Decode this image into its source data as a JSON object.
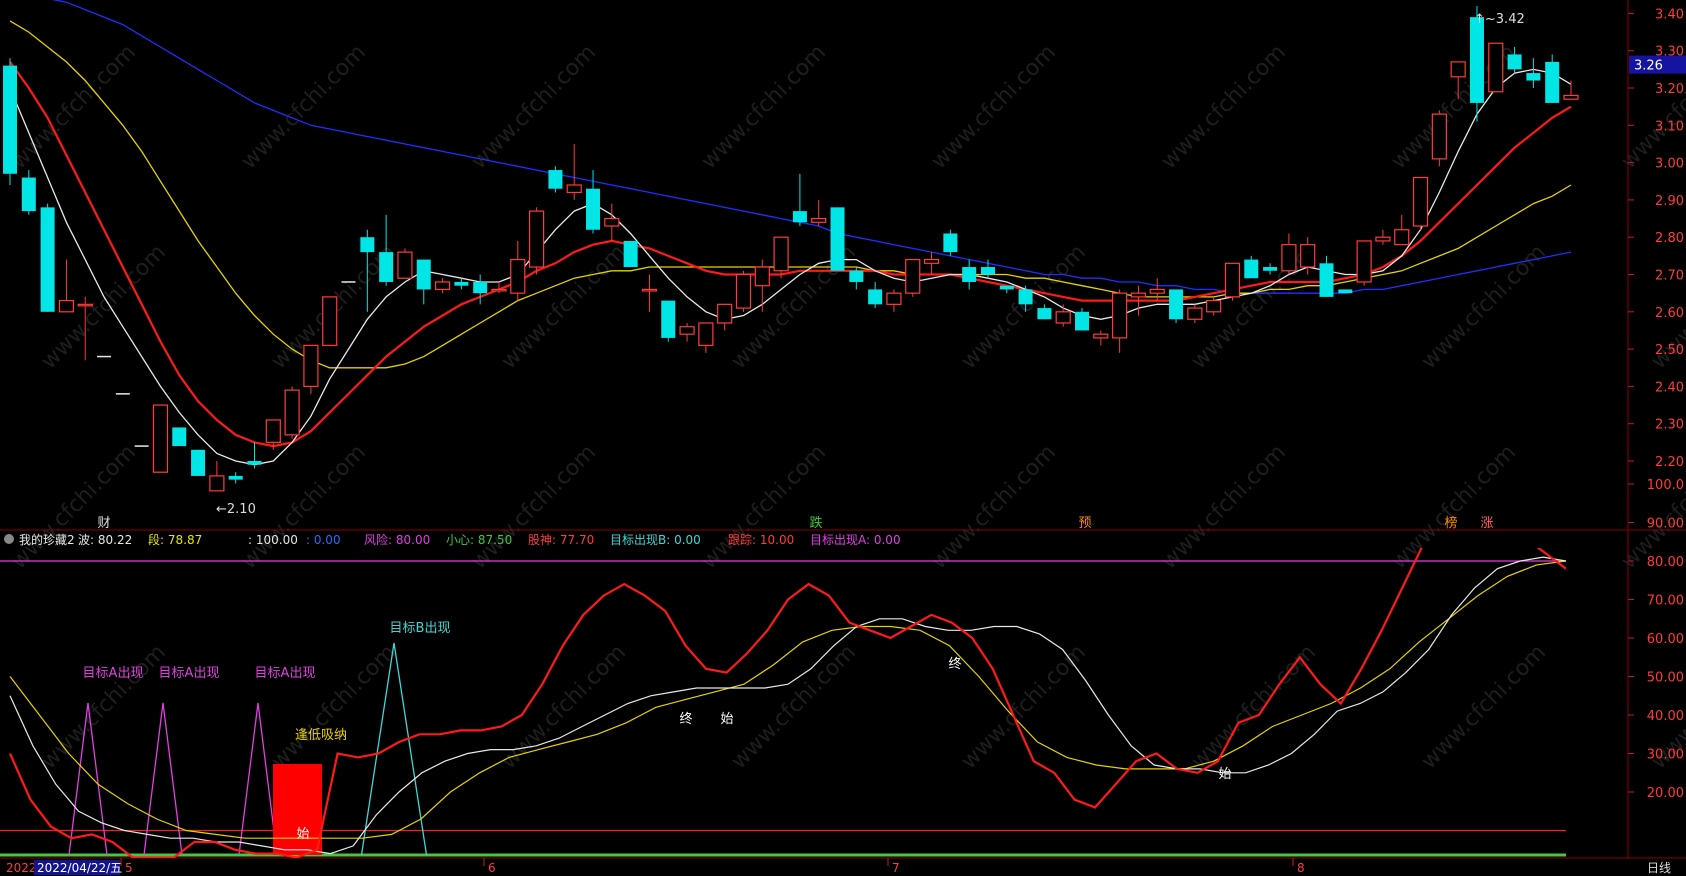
{
  "main_axis": {
    "ticks": [
      "3.40",
      "3.30",
      "3.20",
      "3.10",
      "3.00",
      "2.90",
      "2.80",
      "2.70",
      "2.60",
      "2.50",
      "2.40",
      "2.30",
      "2.20"
    ],
    "current_price": "3.26"
  },
  "main_annotations": {
    "high": "3.42",
    "low": "2.10"
  },
  "event_markers": [
    "财",
    "跌",
    "预",
    "榜",
    "涨"
  ],
  "indicator_header": {
    "name": "我的珍藏2",
    "items": [
      {
        "label": "波:",
        "value": "80.22",
        "color": "#e6e6e6"
      },
      {
        "label": "段:",
        "value": "78.87",
        "color": "#e6e600"
      },
      {
        "label": ":",
        "value": "100.00",
        "color": "#e6e6e6"
      },
      {
        "label": ":",
        "value": "0.00",
        "color": "#2b6bff"
      },
      {
        "label": "风险:",
        "value": "80.00",
        "color": "#e040e0"
      },
      {
        "label": "小心:",
        "value": "87.50",
        "color": "#3ccc3c"
      },
      {
        "label": "股神:",
        "value": "77.70",
        "color": "#ff3b3b"
      },
      {
        "label": "目标出现B:",
        "value": "0.00",
        "color": "#3fd6d6"
      },
      {
        "label": "跟踪:",
        "value": "10.00",
        "color": "#ff3b3b"
      },
      {
        "label": "目标出现A:",
        "value": "0.00",
        "color": "#e040e0"
      }
    ]
  },
  "indicator_axis": {
    "ticks": [
      "100.0",
      "90.00",
      "80.00",
      "70.00",
      "60.00",
      "50.00",
      "40.00",
      "30.00",
      "20.00"
    ]
  },
  "indicator_annotations": {
    "target_a": "目标A出现",
    "target_b": "目标B出现",
    "buy_low": "逢低吸纳",
    "start": "始",
    "end": "终"
  },
  "bottom_axis": {
    "date_prefix": "2022",
    "date_box": "2022/04/22/五",
    "months": [
      "5",
      "6",
      "7",
      "8"
    ],
    "period": "日线"
  },
  "watermark": "www.cfchi.com",
  "colors": {
    "up": "#ff3b3b",
    "down": "#00e6e6",
    "ma5": "#e8e8e8",
    "ma10": "#ff1a1a",
    "ma20": "#e6d200",
    "ma60": "#1f2fff",
    "bg": "#000000"
  },
  "chart_data": {
    "type": "candlestick",
    "ohlc": [
      [
        3.26,
        3.28,
        2.94,
        2.97
      ],
      [
        2.96,
        2.98,
        2.86,
        2.87
      ],
      [
        2.88,
        2.89,
        2.6,
        2.6
      ],
      [
        2.6,
        2.74,
        2.6,
        2.63
      ],
      [
        2.62,
        2.64,
        2.47,
        2.62
      ],
      [
        2.48,
        2.48,
        2.48,
        2.48
      ],
      [
        2.38,
        2.38,
        2.38,
        2.38
      ],
      [
        2.24,
        2.24,
        2.24,
        2.24
      ],
      [
        2.17,
        2.35,
        2.17,
        2.35
      ],
      [
        2.29,
        2.29,
        2.24,
        2.24
      ],
      [
        2.23,
        2.23,
        2.16,
        2.16
      ],
      [
        2.12,
        2.2,
        2.12,
        2.16
      ],
      [
        2.16,
        2.17,
        2.14,
        2.15
      ],
      [
        2.2,
        2.25,
        2.18,
        2.19
      ],
      [
        2.25,
        2.31,
        2.23,
        2.31
      ],
      [
        2.27,
        2.4,
        2.26,
        2.39
      ],
      [
        2.4,
        2.51,
        2.38,
        2.51
      ],
      [
        2.51,
        2.64,
        2.51,
        2.64
      ],
      [
        2.68,
        2.68,
        2.68,
        2.68
      ],
      [
        2.8,
        2.82,
        2.6,
        2.76
      ],
      [
        2.76,
        2.86,
        2.67,
        2.68
      ],
      [
        2.69,
        2.77,
        2.69,
        2.76
      ],
      [
        2.74,
        2.74,
        2.62,
        2.66
      ],
      [
        2.66,
        2.69,
        2.65,
        2.68
      ],
      [
        2.68,
        2.69,
        2.66,
        2.67
      ],
      [
        2.68,
        2.7,
        2.62,
        2.65
      ],
      [
        2.66,
        2.68,
        2.65,
        2.66
      ],
      [
        2.65,
        2.79,
        2.63,
        2.74
      ],
      [
        2.72,
        2.88,
        2.7,
        2.87
      ],
      [
        2.98,
        2.99,
        2.92,
        2.93
      ],
      [
        2.92,
        3.05,
        2.9,
        2.94
      ],
      [
        2.93,
        2.98,
        2.81,
        2.82
      ],
      [
        2.83,
        2.89,
        2.79,
        2.85
      ],
      [
        2.79,
        2.79,
        2.72,
        2.72
      ],
      [
        2.66,
        2.7,
        2.6,
        2.66
      ],
      [
        2.63,
        2.63,
        2.52,
        2.53
      ],
      [
        2.54,
        2.57,
        2.52,
        2.56
      ],
      [
        2.51,
        2.57,
        2.49,
        2.57
      ],
      [
        2.57,
        2.62,
        2.55,
        2.62
      ],
      [
        2.61,
        2.71,
        2.6,
        2.7
      ],
      [
        2.67,
        2.74,
        2.6,
        2.72
      ],
      [
        2.71,
        2.8,
        2.69,
        2.8
      ],
      [
        2.87,
        2.97,
        2.83,
        2.84
      ],
      [
        2.84,
        2.9,
        2.83,
        2.85
      ],
      [
        2.88,
        2.88,
        2.71,
        2.71
      ],
      [
        2.71,
        2.72,
        2.66,
        2.68
      ],
      [
        2.66,
        2.68,
        2.61,
        2.62
      ],
      [
        2.62,
        2.66,
        2.6,
        2.65
      ],
      [
        2.65,
        2.74,
        2.64,
        2.74
      ],
      [
        2.73,
        2.76,
        2.7,
        2.74
      ],
      [
        2.81,
        2.82,
        2.75,
        2.76
      ],
      [
        2.72,
        2.74,
        2.66,
        2.68
      ],
      [
        2.72,
        2.74,
        2.69,
        2.7
      ],
      [
        2.67,
        2.67,
        2.65,
        2.66
      ],
      [
        2.66,
        2.67,
        2.6,
        2.62
      ],
      [
        2.61,
        2.62,
        2.58,
        2.58
      ],
      [
        2.57,
        2.62,
        2.56,
        2.6
      ],
      [
        2.6,
        2.61,
        2.55,
        2.55
      ],
      [
        2.53,
        2.55,
        2.51,
        2.54
      ],
      [
        2.53,
        2.66,
        2.49,
        2.65
      ],
      [
        2.64,
        2.67,
        2.59,
        2.65
      ],
      [
        2.65,
        2.69,
        2.63,
        2.66
      ],
      [
        2.66,
        2.66,
        2.57,
        2.58
      ],
      [
        2.58,
        2.62,
        2.57,
        2.61
      ],
      [
        2.6,
        2.64,
        2.59,
        2.63
      ],
      [
        2.64,
        2.73,
        2.63,
        2.73
      ],
      [
        2.74,
        2.75,
        2.69,
        2.69
      ],
      [
        2.72,
        2.73,
        2.7,
        2.71
      ],
      [
        2.71,
        2.81,
        2.7,
        2.78
      ],
      [
        2.72,
        2.8,
        2.7,
        2.78
      ],
      [
        2.73,
        2.75,
        2.64,
        2.64
      ],
      [
        2.66,
        2.66,
        2.65,
        2.65
      ],
      [
        2.68,
        2.79,
        2.67,
        2.79
      ],
      [
        2.79,
        2.82,
        2.78,
        2.8
      ],
      [
        2.78,
        2.86,
        2.78,
        2.82
      ],
      [
        2.83,
        2.96,
        2.82,
        2.96
      ],
      [
        3.01,
        3.14,
        2.99,
        3.13
      ],
      [
        3.23,
        3.27,
        3.17,
        3.27
      ],
      [
        3.39,
        3.42,
        3.11,
        3.16
      ],
      [
        3.19,
        3.32,
        3.19,
        3.32
      ],
      [
        3.29,
        3.31,
        3.24,
        3.25
      ],
      [
        3.24,
        3.28,
        3.2,
        3.22
      ],
      [
        3.27,
        3.29,
        3.16,
        3.16
      ],
      [
        3.17,
        3.22,
        3.17,
        3.18
      ]
    ],
    "ma5": [
      3.2,
      3.08,
      2.96,
      2.84,
      2.74,
      2.64,
      2.56,
      2.48,
      2.4,
      2.33,
      2.27,
      2.22,
      2.2,
      2.19,
      2.2,
      2.25,
      2.32,
      2.42,
      2.5,
      2.58,
      2.64,
      2.68,
      2.71,
      2.7,
      2.69,
      2.68,
      2.68,
      2.7,
      2.76,
      2.82,
      2.87,
      2.89,
      2.86,
      2.81,
      2.75,
      2.69,
      2.64,
      2.6,
      2.58,
      2.59,
      2.62,
      2.66,
      2.7,
      2.73,
      2.74,
      2.74,
      2.71,
      2.69,
      2.68,
      2.69,
      2.7,
      2.7,
      2.69,
      2.68,
      2.66,
      2.64,
      2.61,
      2.59,
      2.58,
      2.59,
      2.61,
      2.62,
      2.62,
      2.62,
      2.63,
      2.64,
      2.65,
      2.67,
      2.7,
      2.72,
      2.71,
      2.7,
      2.7,
      2.71,
      2.75,
      2.82,
      2.92,
      3.03,
      3.13,
      3.2,
      3.24,
      3.25,
      3.24,
      3.21
    ],
    "ma10": [
      3.27,
      3.2,
      3.12,
      3.02,
      2.92,
      2.82,
      2.72,
      2.62,
      2.52,
      2.43,
      2.36,
      2.31,
      2.27,
      2.25,
      2.24,
      2.25,
      2.28,
      2.33,
      2.38,
      2.43,
      2.48,
      2.52,
      2.56,
      2.59,
      2.62,
      2.64,
      2.66,
      2.68,
      2.71,
      2.73,
      2.76,
      2.78,
      2.79,
      2.78,
      2.77,
      2.75,
      2.73,
      2.71,
      2.7,
      2.7,
      2.7,
      2.7,
      2.71,
      2.71,
      2.71,
      2.71,
      2.71,
      2.7,
      2.7,
      2.7,
      2.7,
      2.69,
      2.68,
      2.67,
      2.66,
      2.65,
      2.64,
      2.63,
      2.63,
      2.63,
      2.63,
      2.63,
      2.63,
      2.64,
      2.65,
      2.66,
      2.67,
      2.68,
      2.68,
      2.68,
      2.68,
      2.69,
      2.7,
      2.72,
      2.75,
      2.79,
      2.84,
      2.89,
      2.94,
      2.99,
      3.04,
      3.08,
      3.12,
      3.15
    ],
    "ma20": [
      3.38,
      3.35,
      3.31,
      3.27,
      3.22,
      3.16,
      3.1,
      3.03,
      2.95,
      2.87,
      2.79,
      2.72,
      2.65,
      2.59,
      2.54,
      2.5,
      2.47,
      2.45,
      2.45,
      2.45,
      2.45,
      2.46,
      2.48,
      2.51,
      2.54,
      2.57,
      2.6,
      2.63,
      2.65,
      2.67,
      2.69,
      2.7,
      2.71,
      2.71,
      2.72,
      2.72,
      2.72,
      2.72,
      2.72,
      2.72,
      2.72,
      2.72,
      2.72,
      2.72,
      2.72,
      2.72,
      2.71,
      2.71,
      2.7,
      2.7,
      2.7,
      2.7,
      2.7,
      2.7,
      2.69,
      2.69,
      2.68,
      2.67,
      2.66,
      2.65,
      2.64,
      2.64,
      2.64,
      2.64,
      2.64,
      2.65,
      2.65,
      2.66,
      2.66,
      2.67,
      2.67,
      2.68,
      2.69,
      2.7,
      2.71,
      2.73,
      2.75,
      2.77,
      2.8,
      2.83,
      2.86,
      2.89,
      2.91,
      2.94
    ],
    "ma60": [
      3.46,
      3.45,
      3.44,
      3.43,
      3.41,
      3.39,
      3.37,
      3.34,
      3.31,
      3.28,
      3.25,
      3.22,
      3.19,
      3.16,
      3.14,
      3.12,
      3.1,
      3.09,
      3.08,
      3.07,
      3.06,
      3.05,
      3.04,
      3.03,
      3.02,
      3.01,
      3.0,
      2.99,
      2.98,
      2.97,
      2.96,
      2.95,
      2.94,
      2.93,
      2.92,
      2.91,
      2.9,
      2.89,
      2.88,
      2.87,
      2.86,
      2.85,
      2.84,
      2.83,
      2.81,
      2.8,
      2.79,
      2.78,
      2.77,
      2.76,
      2.75,
      2.74,
      2.73,
      2.72,
      2.71,
      2.7,
      2.7,
      2.69,
      2.69,
      2.68,
      2.68,
      2.67,
      2.67,
      2.66,
      2.66,
      2.65,
      2.65,
      2.65,
      2.65,
      2.65,
      2.65,
      2.65,
      2.66,
      2.66,
      2.67,
      2.68,
      2.69,
      2.7,
      2.71,
      2.72,
      2.73,
      2.74,
      2.75,
      2.76
    ],
    "ind_red": [
      30,
      18,
      11,
      8,
      9,
      7,
      3,
      3,
      3,
      7,
      7,
      5,
      4,
      4,
      3,
      5,
      30,
      29,
      30,
      33,
      35,
      35,
      36,
      36,
      37,
      40,
      48,
      58,
      66,
      71,
      74,
      71,
      67,
      58,
      52,
      51,
      56,
      62,
      70,
      74,
      71,
      64,
      62,
      60,
      63,
      66,
      64,
      60,
      52,
      40,
      28,
      25,
      18,
      16,
      22,
      28,
      30,
      26,
      25,
      28,
      38,
      40,
      48,
      55,
      48,
      43,
      52,
      62,
      73,
      84,
      90,
      95,
      88,
      88,
      86,
      82,
      78
    ],
    "ind_white": [
      45,
      32,
      22,
      15,
      12,
      10,
      9,
      8,
      8,
      7,
      7,
      6,
      5,
      5,
      4,
      6,
      14,
      20,
      25,
      28,
      30,
      31,
      31,
      32,
      34,
      37,
      40,
      43,
      45,
      46,
      47,
      47,
      47,
      47,
      48,
      52,
      58,
      63,
      65,
      65,
      63,
      62,
      62,
      63,
      63,
      61,
      57,
      49,
      40,
      32,
      27,
      26,
      26,
      25,
      25,
      27,
      30,
      35,
      41,
      43,
      46,
      51,
      57,
      66,
      73,
      78,
      80,
      81,
      80
    ],
    "ind_yellow": [
      50,
      40,
      30,
      22,
      17,
      13,
      10,
      9,
      8,
      8,
      8,
      8,
      8,
      9,
      13,
      20,
      25,
      29,
      31,
      33,
      35,
      38,
      42,
      44,
      46,
      48,
      53,
      59,
      62,
      63,
      63,
      62,
      58,
      50,
      41,
      33,
      29,
      27,
      26,
      26,
      26,
      28,
      32,
      37,
      40,
      43,
      47,
      52,
      59,
      65,
      71,
      76,
      79,
      80
    ]
  }
}
